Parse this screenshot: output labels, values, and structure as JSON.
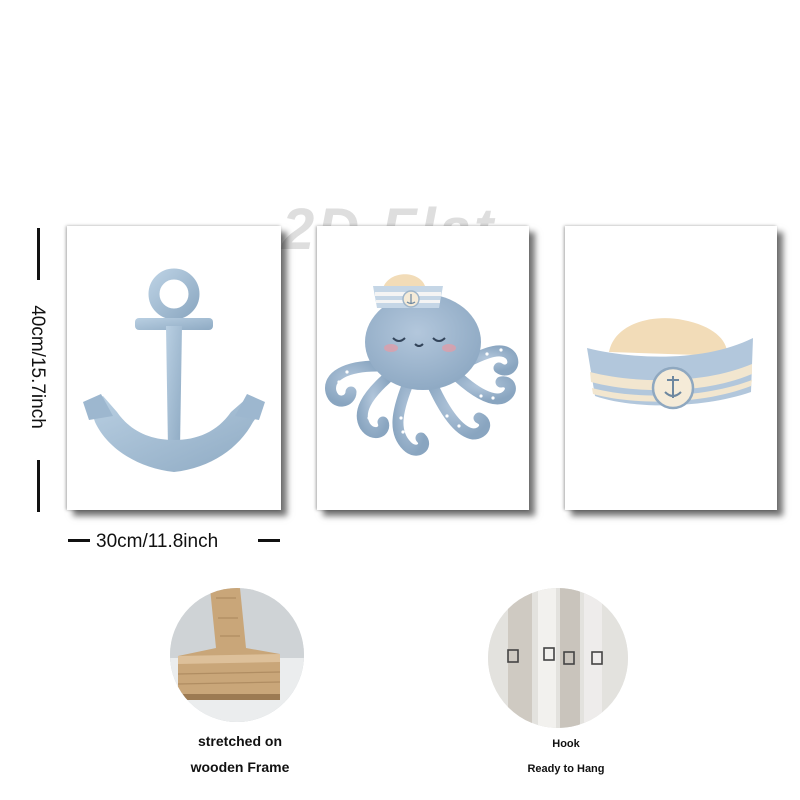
{
  "watermark": "2D Flat",
  "dimensions": {
    "height_label": "40cm/15.7inch",
    "width_label": "30cm/11.8inch"
  },
  "panels": [
    {
      "subject": "anchor"
    },
    {
      "subject": "octopus-sailor"
    },
    {
      "subject": "sailor-hat"
    }
  ],
  "features": [
    {
      "lines": [
        "stretched on",
        "wooden Frame"
      ]
    },
    {
      "lines": [
        "Hook",
        "Ready to Hang"
      ]
    }
  ],
  "colors": {
    "illustration_blue": "#a9c1d6",
    "illustration_dark": "#7f9bb5",
    "cream": "#f2dcb8",
    "wood": "#c9a679"
  }
}
